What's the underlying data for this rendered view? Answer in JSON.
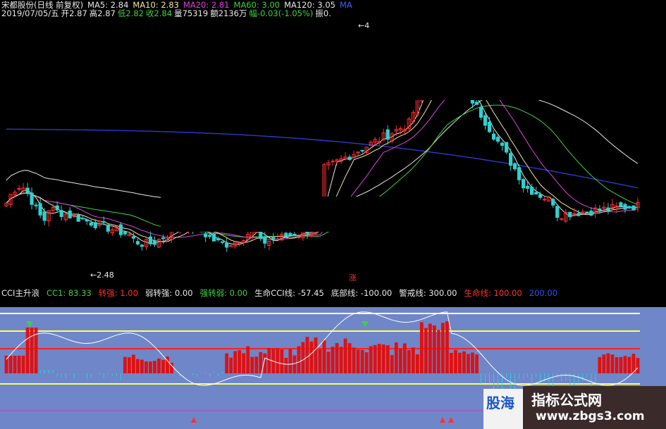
{
  "header": {
    "stock_name": "宋都股份(日线 前复权)",
    "ma_items": [
      {
        "label": "MA5: 2.84",
        "color": "#e8e8e8"
      },
      {
        "label": "MA10: 2.83",
        "color": "#f2e6a0"
      },
      {
        "label": "MA20: 2.81",
        "color": "#e040e0"
      },
      {
        "label": "MA60: 3.00",
        "color": "#40d040"
      },
      {
        "label": "MA120: 3.05",
        "color": "#e8e8e8"
      },
      {
        "label": "MA",
        "color": "#4060ff"
      }
    ],
    "ohlc": [
      {
        "label": "2019/07/05/五",
        "color": "#e8e8e8"
      },
      {
        "label": "开2.87",
        "color": "#e8e8e8"
      },
      {
        "label": "高2.87",
        "color": "#e8e8e8"
      },
      {
        "label": "低2.82",
        "color": "#40d040"
      },
      {
        "label": "收2.84",
        "color": "#40d040"
      },
      {
        "label": "量75319",
        "color": "#e8e8e8"
      },
      {
        "label": "额2136万",
        "color": "#e8e8e8"
      },
      {
        "label": "幅-0.03(-1.05%)",
        "color": "#40d040"
      },
      {
        "label": "振0.",
        "color": "#e8e8e8"
      }
    ]
  },
  "indicator_header": [
    {
      "label": "CCI主升浪",
      "color": "#e8e8e8"
    },
    {
      "label": "CC1: 83.33",
      "color": "#40d040"
    },
    {
      "label": "转强: 1.00",
      "color": "#ff3030"
    },
    {
      "label": "弱转强: 0.00",
      "color": "#e8e8e8"
    },
    {
      "label": "强转弱: 0.00",
      "color": "#40d040"
    },
    {
      "label": "生命CCI线: -57.45",
      "color": "#e8e8e8"
    },
    {
      "label": "底部线: -100.00",
      "color": "#e8e8e8"
    },
    {
      "label": "警戒线: 300.00",
      "color": "#e8e8e8"
    },
    {
      "label": "生命线: 100.00",
      "color": "#ff3030"
    },
    {
      "label": "200.00",
      "color": "#3050ff"
    }
  ],
  "colors": {
    "up": "#ff3030",
    "down": "#30d0d0",
    "ind_bg": "#6f86c8",
    "ma5": "#e8e8e8",
    "ma10": "#f2e6a0",
    "ma20": "#e040e0",
    "ma60": "#40d040",
    "ma120": "#e8e8e8",
    "ma250": "#2a3acc"
  },
  "chart_data": [
    {
      "type": "candlestick",
      "title": "宋都股份(日线 前复权)",
      "annotations": [
        "2.48",
        "4"
      ],
      "price_range": [
        2.3,
        4.5
      ],
      "candles": [],
      "marks": [
        "涨"
      ]
    },
    {
      "type": "bar",
      "title": "CCI主升浪",
      "reference_lines": [
        -100,
        0,
        100,
        200,
        300
      ],
      "ylim": [
        -250,
        350
      ],
      "values": []
    }
  ],
  "watermark": {
    "title": "指标公式网",
    "url": "www.zbgs3.com",
    "left_text": "股海"
  }
}
